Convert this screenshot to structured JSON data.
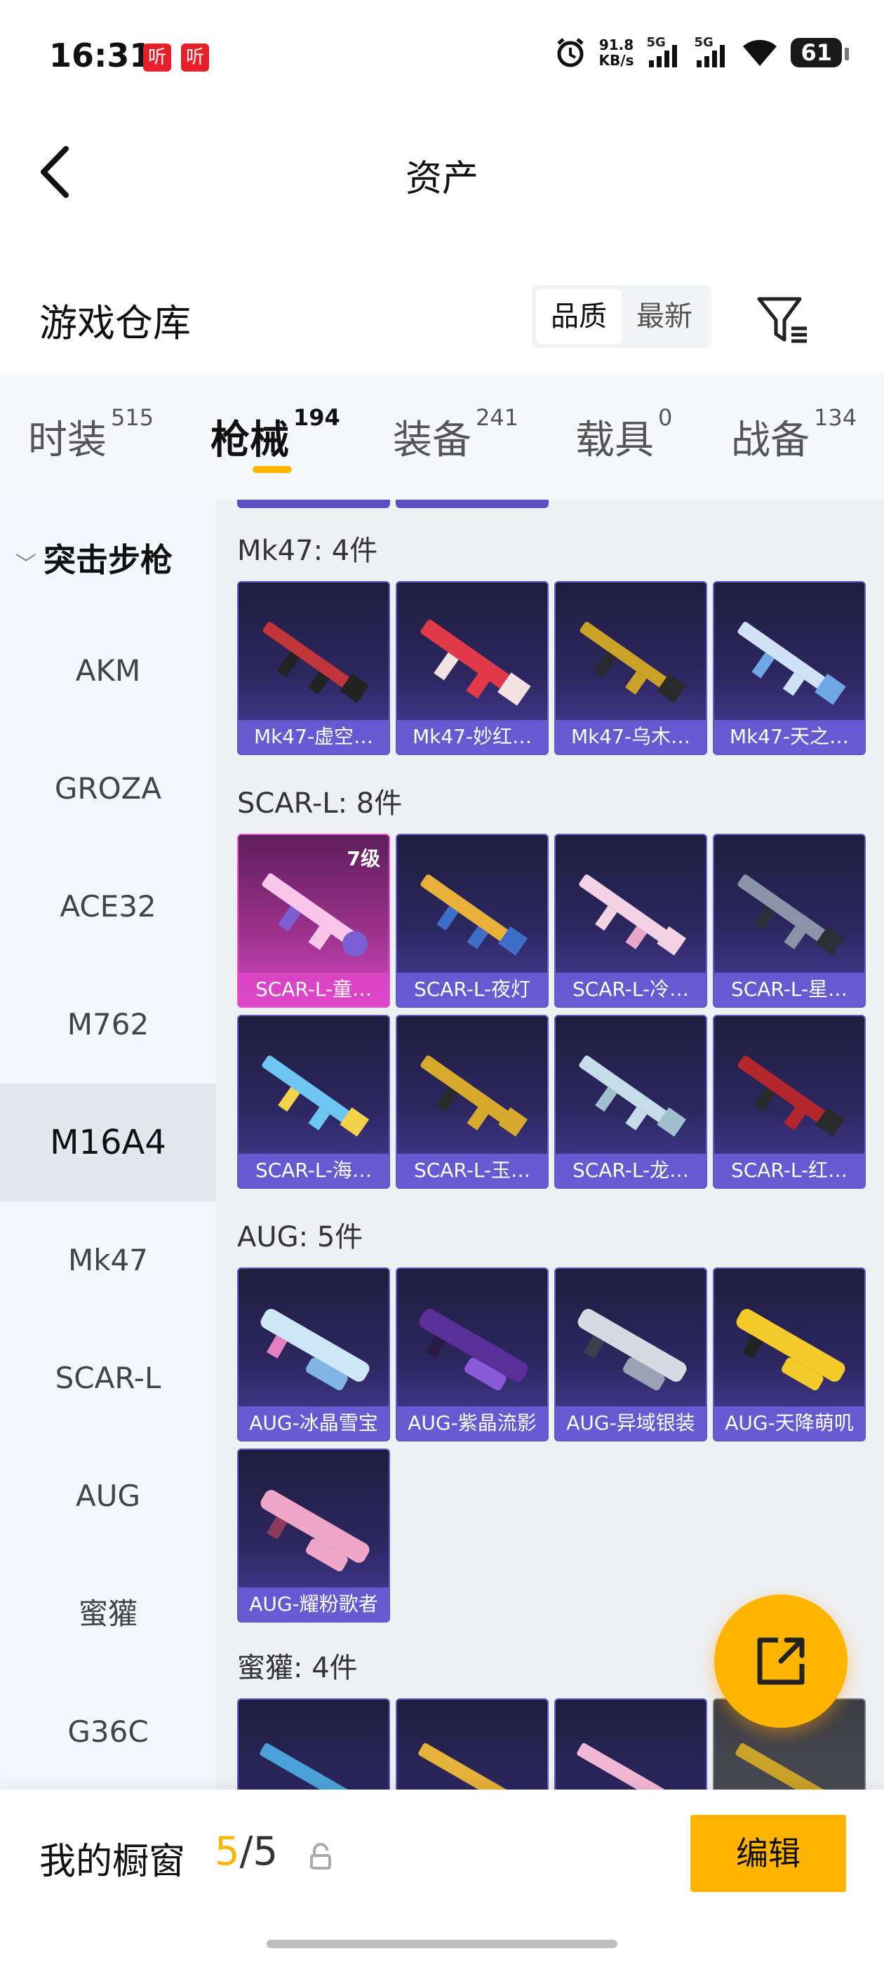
{
  "status_bar": {
    "time": "16:31",
    "badge1": "听",
    "badge2": "听",
    "speed_value": "91.8",
    "speed_unit": "KB/s",
    "net1": "5G",
    "net2": "5G",
    "battery": "61"
  },
  "nav": {
    "title": "资产"
  },
  "warehouse": {
    "title": "游戏仓库",
    "sort_options": [
      "品质",
      "最新"
    ],
    "sort_active": "品质"
  },
  "tabs": [
    {
      "label": "时装",
      "count": "515"
    },
    {
      "label": "枪械",
      "count": "194"
    },
    {
      "label": "装备",
      "count": "241"
    },
    {
      "label": "载具",
      "count": "0"
    },
    {
      "label": "战备",
      "count": "134"
    }
  ],
  "sidebar": {
    "category": "突击步枪",
    "items": [
      "AKM",
      "GROZA",
      "ACE32",
      "M762",
      "M16A4",
      "Mk47",
      "SCAR-L",
      "AUG",
      "蜜獾",
      "G36C"
    ],
    "active": "M16A4"
  },
  "groups": [
    {
      "title": "Mk47: 4件",
      "items": [
        "Mk47-虚空…",
        "Mk47-妙红…",
        "Mk47-乌木…",
        "Mk47-天之…"
      ]
    },
    {
      "title": "SCAR-L: 8件",
      "items": [
        "SCAR-L-童…",
        "SCAR-L-夜灯",
        "SCAR-L-冷…",
        "SCAR-L-星…",
        "SCAR-L-海…",
        "SCAR-L-玉…",
        "SCAR-L-龙…",
        "SCAR-L-红…"
      ],
      "first_level": "7级"
    },
    {
      "title": "AUG: 5件",
      "items": [
        "AUG-冰晶雪宝",
        "AUG-紫晶流影",
        "AUG-异域银装",
        "AUG-天降萌叽",
        "AUG-耀粉歌者"
      ]
    },
    {
      "title": "蜜獾: 4件"
    }
  ],
  "colors": {
    "accent": "#ffb400",
    "card_purple": "#4b3f9e",
    "card_pink": "#d44bc3"
  },
  "showcase": {
    "title": "我的橱窗",
    "count_current": "5",
    "count_total": "/5",
    "edit_label": "编辑"
  }
}
